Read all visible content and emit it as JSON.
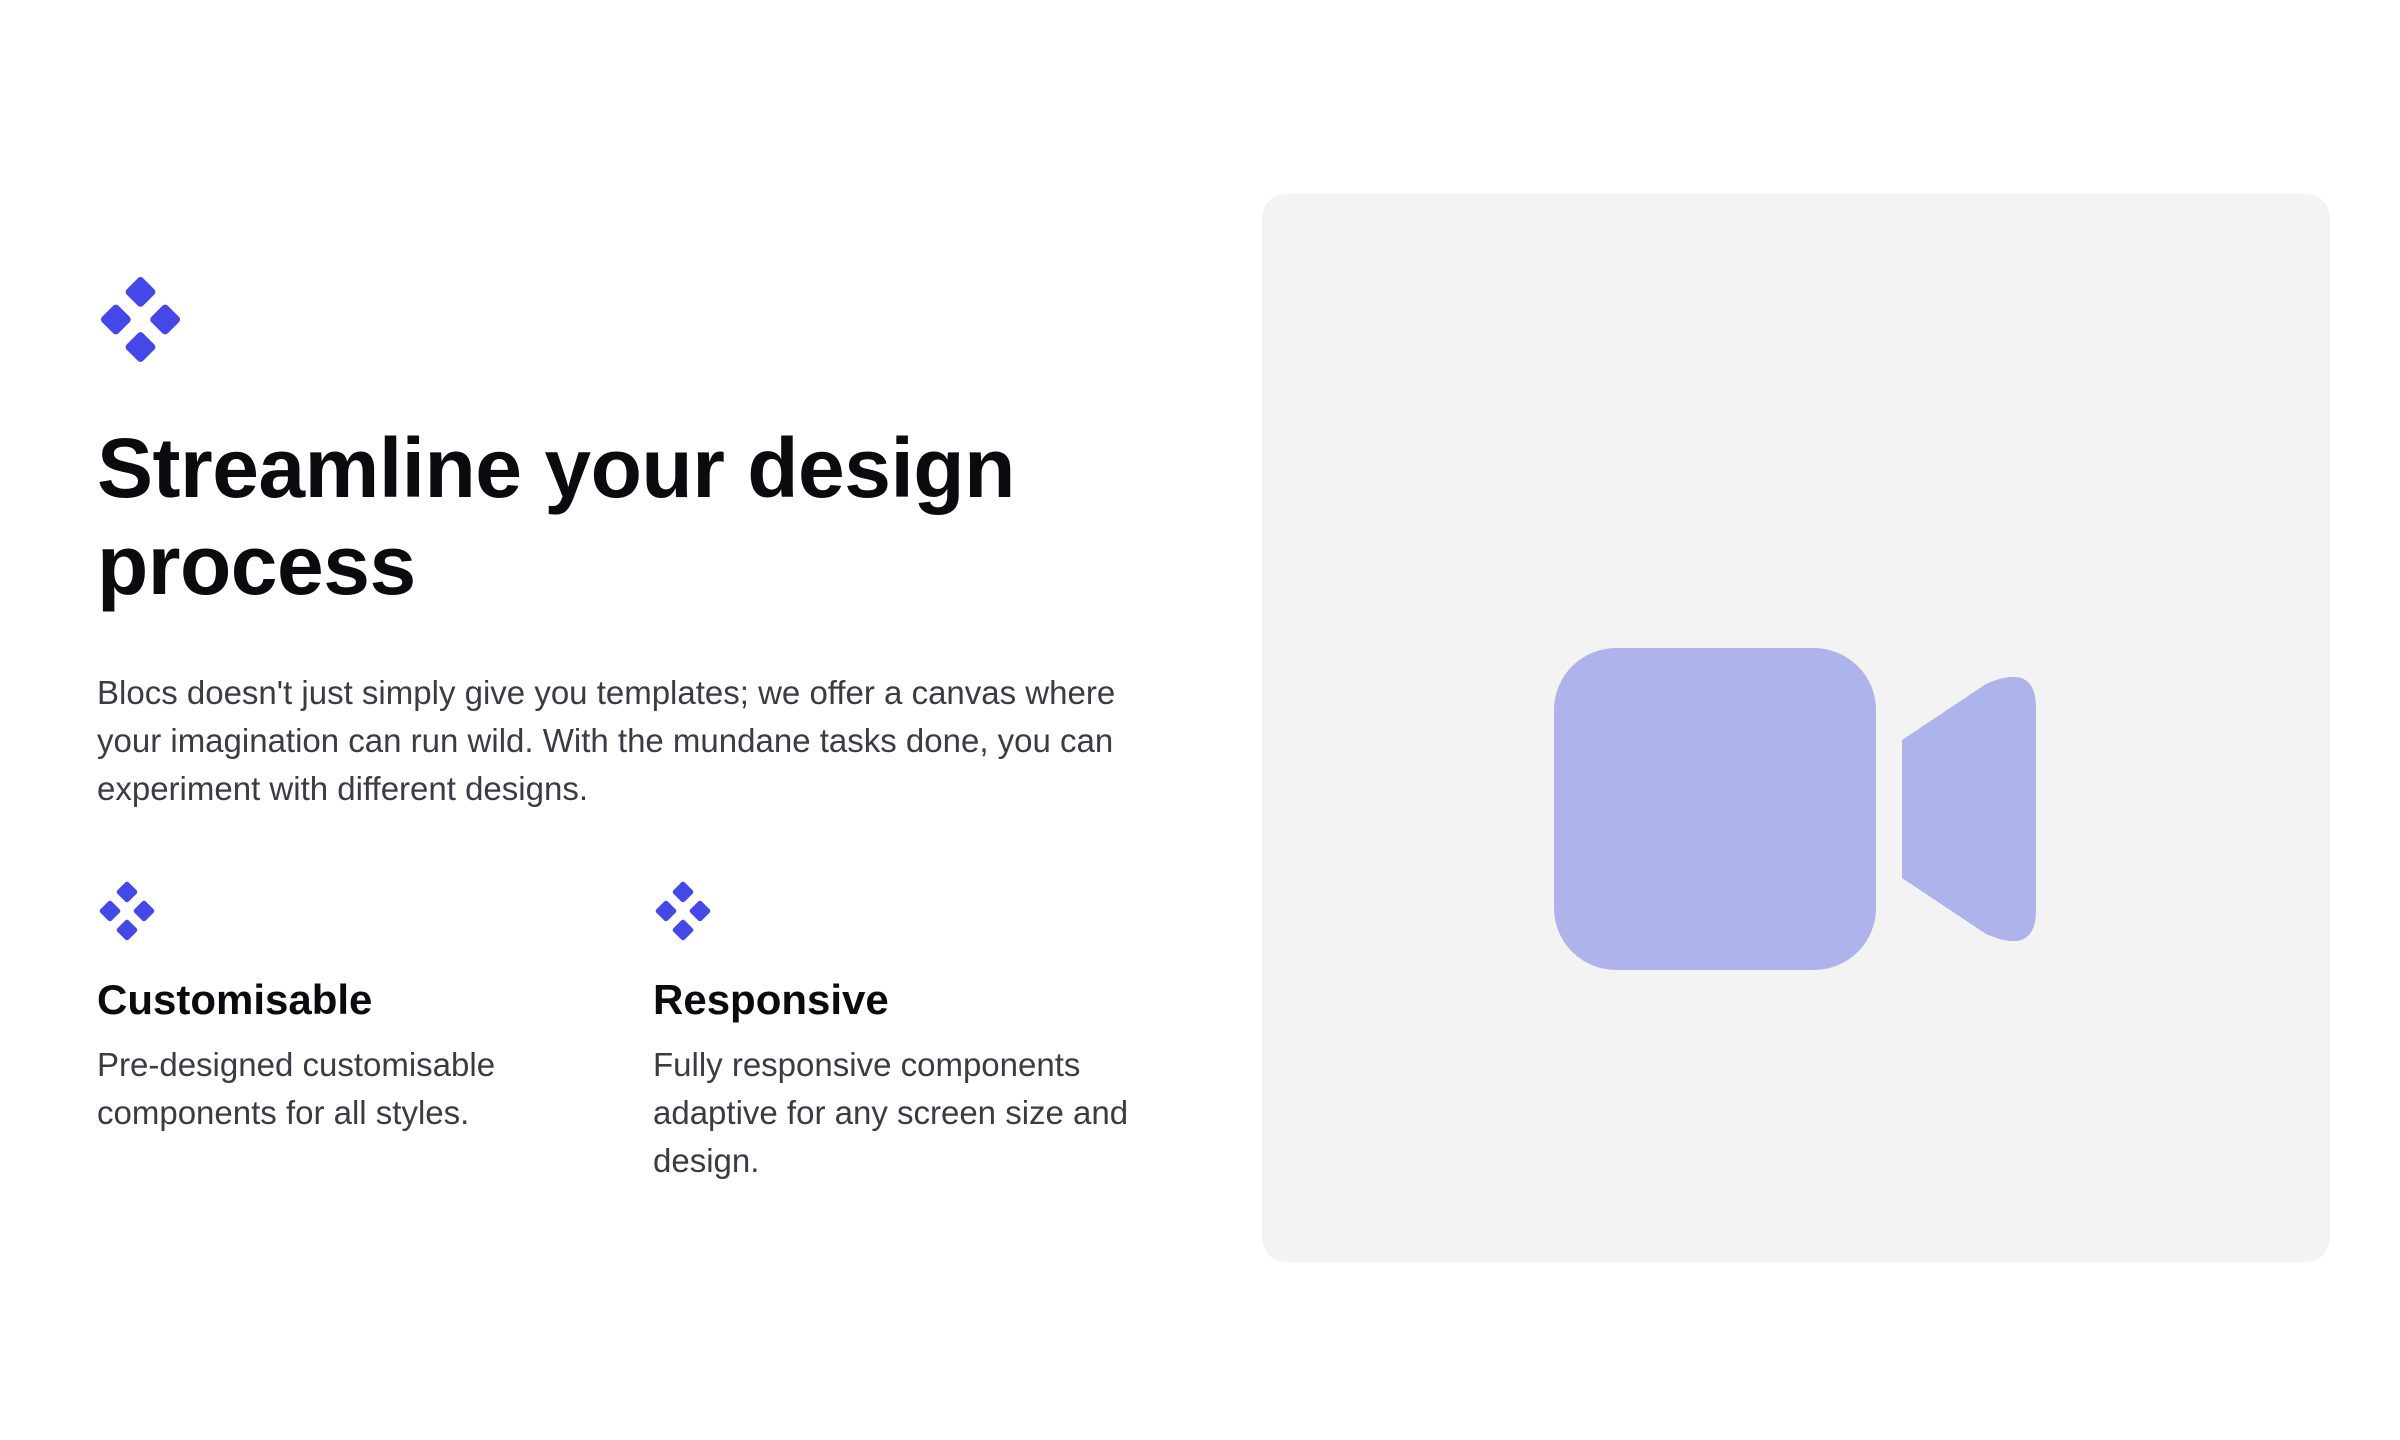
{
  "brand": {
    "accent_color": "#4448e8",
    "logo_icon": "diamond-cluster-icon"
  },
  "hero": {
    "title": "Streamline your design process",
    "description": "Blocs doesn't just simply give you templates; we offer a canvas where your imagination can run wild. With the mundane tasks done, you can experiment with different designs."
  },
  "features": [
    {
      "icon": "diamond-cluster-icon",
      "title": "Customisable",
      "description": "Pre-designed customisable components for all styles."
    },
    {
      "icon": "diamond-cluster-icon",
      "title": "Responsive",
      "description": "Fully responsive components adaptive for any screen size and design."
    }
  ],
  "media": {
    "icon": "video-camera-icon",
    "background_color": "#f3f3f4",
    "icon_color": "#afb3eb"
  }
}
